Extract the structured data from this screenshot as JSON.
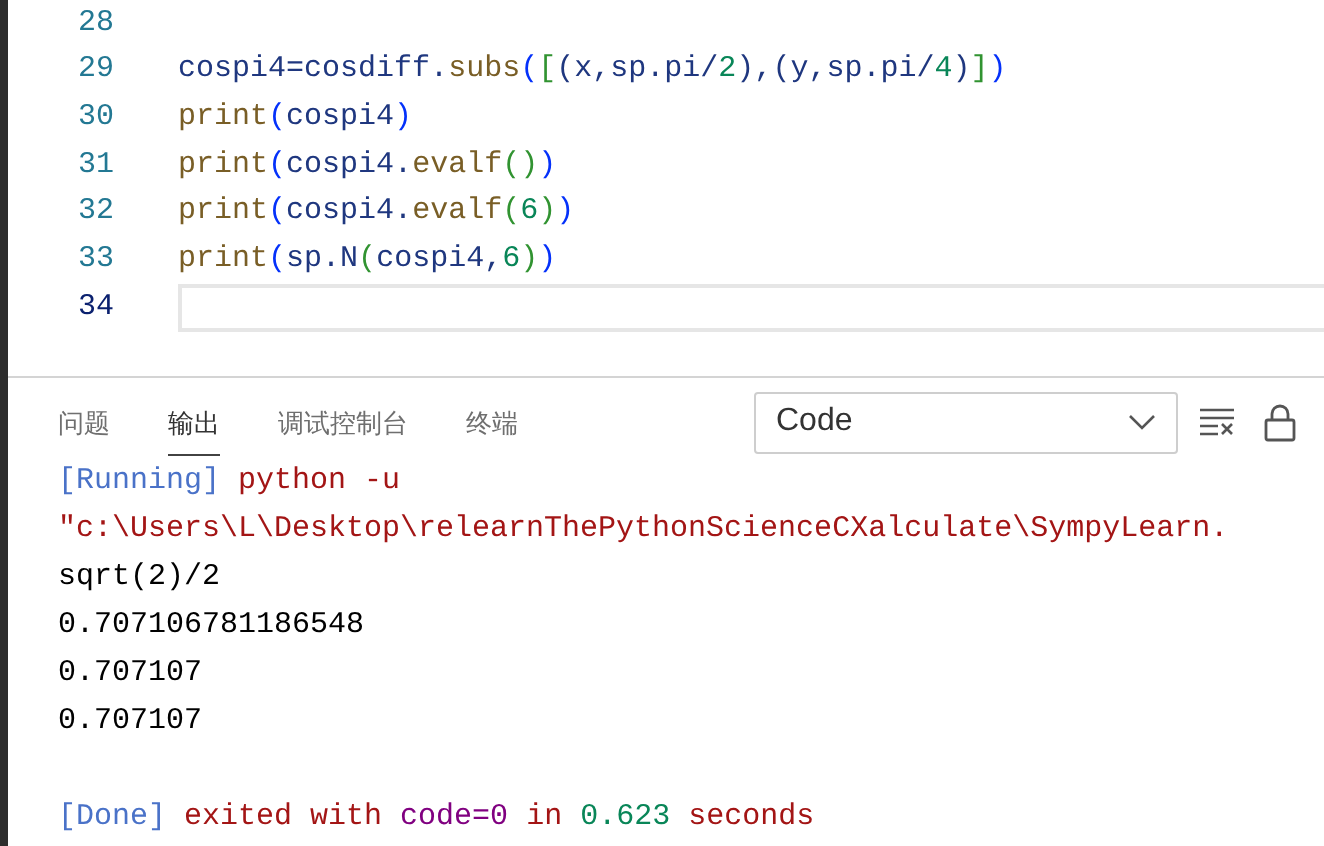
{
  "editor": {
    "lines": [
      {
        "number": "28",
        "current": false
      },
      {
        "number": "29",
        "current": false,
        "tokens": [
          {
            "kind": "var",
            "text": "cospi4"
          },
          {
            "kind": "op",
            "text": "="
          },
          {
            "kind": "var",
            "text": "cosdiff"
          },
          {
            "kind": "op",
            "text": "."
          },
          {
            "kind": "func",
            "text": "subs"
          },
          {
            "kind": "b1",
            "text": "("
          },
          {
            "kind": "b2",
            "text": "["
          },
          {
            "kind": "b3",
            "text": "("
          },
          {
            "kind": "var",
            "text": "x,sp.pi/"
          },
          {
            "kind": "num",
            "text": "2"
          },
          {
            "kind": "b3",
            "text": ")"
          },
          {
            "kind": "op",
            "text": ","
          },
          {
            "kind": "b3",
            "text": "("
          },
          {
            "kind": "var",
            "text": "y,sp.pi/"
          },
          {
            "kind": "num",
            "text": "4"
          },
          {
            "kind": "b3",
            "text": ")"
          },
          {
            "kind": "b2",
            "text": "]"
          },
          {
            "kind": "b1",
            "text": ")"
          }
        ]
      },
      {
        "number": "30",
        "current": false,
        "tokens": [
          {
            "kind": "func",
            "text": "print"
          },
          {
            "kind": "b1",
            "text": "("
          },
          {
            "kind": "var",
            "text": "cospi4"
          },
          {
            "kind": "b1",
            "text": ")"
          }
        ]
      },
      {
        "number": "31",
        "current": false,
        "tokens": [
          {
            "kind": "func",
            "text": "print"
          },
          {
            "kind": "b1",
            "text": "("
          },
          {
            "kind": "var",
            "text": "cospi4"
          },
          {
            "kind": "op",
            "text": "."
          },
          {
            "kind": "func",
            "text": "evalf"
          },
          {
            "kind": "b2",
            "text": "()"
          },
          {
            "kind": "b1",
            "text": ")"
          }
        ]
      },
      {
        "number": "32",
        "current": false,
        "tokens": [
          {
            "kind": "func",
            "text": "print"
          },
          {
            "kind": "b1",
            "text": "("
          },
          {
            "kind": "var",
            "text": "cospi4"
          },
          {
            "kind": "op",
            "text": "."
          },
          {
            "kind": "func",
            "text": "evalf"
          },
          {
            "kind": "b2",
            "text": "("
          },
          {
            "kind": "num",
            "text": "6"
          },
          {
            "kind": "b2",
            "text": ")"
          },
          {
            "kind": "b1",
            "text": ")"
          }
        ]
      },
      {
        "number": "33",
        "current": false,
        "tokens": [
          {
            "kind": "func",
            "text": "print"
          },
          {
            "kind": "b1",
            "text": "("
          },
          {
            "kind": "var",
            "text": "sp.N"
          },
          {
            "kind": "b2",
            "text": "("
          },
          {
            "kind": "var",
            "text": "cospi4,"
          },
          {
            "kind": "num",
            "text": "6"
          },
          {
            "kind": "b2",
            "text": ")"
          },
          {
            "kind": "b1",
            "text": ")"
          }
        ]
      },
      {
        "number": "34",
        "current": true
      }
    ]
  },
  "panel": {
    "tabs": [
      {
        "label": "问题",
        "selected": false
      },
      {
        "label": "输出",
        "selected": true
      },
      {
        "label": "调试控制台",
        "selected": false
      },
      {
        "label": "终端",
        "selected": false
      }
    ],
    "channel_select": {
      "value": "Code"
    },
    "output": [
      {
        "kind": "log",
        "segments": [
          {
            "kind": "tag",
            "text": "[Running]"
          },
          {
            "kind": "cmd",
            "text": " python -u"
          }
        ]
      },
      {
        "kind": "log",
        "segments": [
          {
            "kind": "cmd",
            "text": "\"c:\\Users\\L\\Desktop\\relearnThePythonScienceCXalculate\\SympyLearn."
          }
        ]
      },
      {
        "kind": "log",
        "segments": [
          {
            "kind": "plain",
            "text": "sqrt(2)/2"
          }
        ]
      },
      {
        "kind": "log",
        "segments": [
          {
            "kind": "plain",
            "text": "0.707106781186548"
          }
        ]
      },
      {
        "kind": "log",
        "segments": [
          {
            "kind": "plain",
            "text": "0.707107"
          }
        ]
      },
      {
        "kind": "log",
        "segments": [
          {
            "kind": "plain",
            "text": "0.707107"
          }
        ]
      },
      {
        "kind": "done",
        "segments": [
          {
            "kind": "tag",
            "text": "[Done]"
          },
          {
            "kind": "cmd",
            "text": " exited with "
          },
          {
            "kind": "code",
            "text": "code=0"
          },
          {
            "kind": "cmd",
            "text": " in "
          },
          {
            "kind": "num",
            "text": "0.623"
          },
          {
            "kind": "cmd",
            "text": " seconds"
          }
        ]
      }
    ]
  }
}
